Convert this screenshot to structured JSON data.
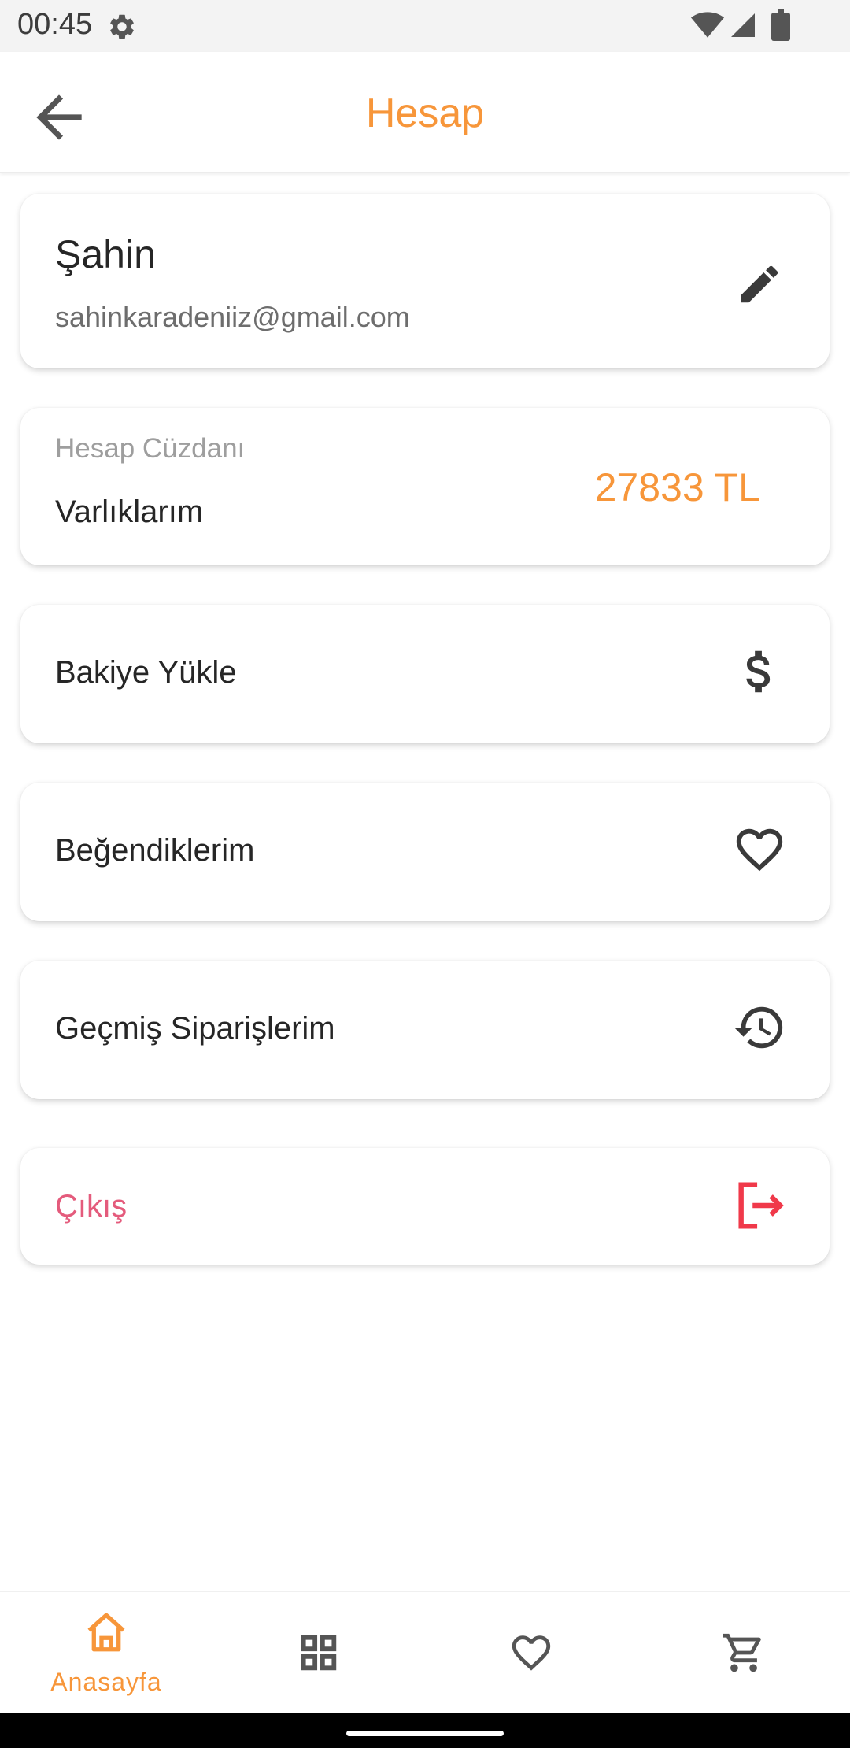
{
  "status_bar": {
    "time": "00:45",
    "icons": [
      "settings-gear-icon",
      "wifi-icon",
      "signal-icon",
      "battery-icon"
    ]
  },
  "header": {
    "title": "Hesap",
    "back_icon": "arrow-back-icon"
  },
  "profile": {
    "name": "Şahin",
    "email": "sahinkaradeniiz@gmail.com",
    "edit_icon": "pencil-edit-icon"
  },
  "wallet": {
    "label": "Hesap Cüzdanı",
    "subtitle": "Varlıklarım",
    "amount": "27833 TL"
  },
  "menu": {
    "topup": {
      "label": "Bakiye Yükle",
      "icon": "dollar-icon"
    },
    "likes": {
      "label": "Beğendiklerim",
      "icon": "heart-outline-icon"
    },
    "orders": {
      "label": "Geçmiş Siparişlerim",
      "icon": "history-icon"
    },
    "logout": {
      "label": "Çıkış",
      "icon": "logout-icon"
    }
  },
  "bottom_nav": {
    "home_label": "Anasayfa",
    "items": [
      "home-icon",
      "categories-grid-icon",
      "favorites-heart-icon",
      "cart-icon"
    ],
    "active": "home"
  },
  "colors": {
    "accent": "#f7963a",
    "logout_text": "#e45b7c",
    "logout_icon": "#f0394a",
    "icon_gray": "#555555"
  }
}
